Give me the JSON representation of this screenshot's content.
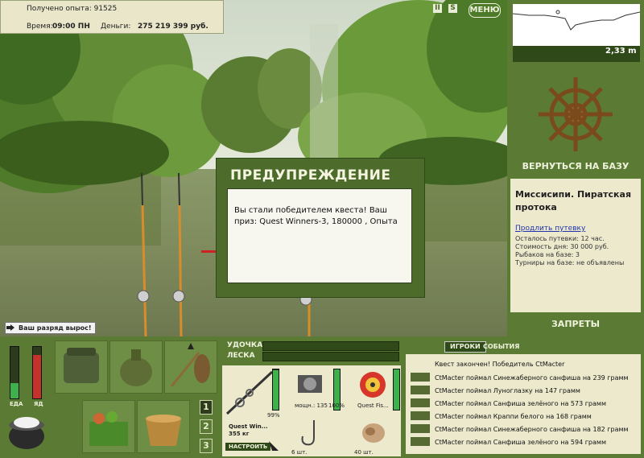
{
  "hud": {
    "exp_label": "Получено опыта: 91525",
    "time_label": "Время:",
    "time_value": "09:00 ПН",
    "money_label": "Деньги:",
    "money_value": "275 219 399 руб.",
    "pause_glyph": "II",
    "sound_glyph": "S",
    "menu_label": "МЕНЮ"
  },
  "depth": {
    "value": "2,33 m"
  },
  "right_panel": {
    "base_button": "ВЕРНУТЬСЯ НА БАЗУ",
    "location_title": "Миссисипи. Пиратская протока",
    "extend_link": "Продлить путевку",
    "trip_left": "Осталось путевки: 12 час.",
    "day_cost": "Стоимость дня: 30 000 руб.",
    "anglers": "Рыбаков на базе: 3",
    "tournaments": "Турниры на базе: не объявлены",
    "bans_button": "ЗАПРЕТЫ"
  },
  "modal": {
    "title": "ПРЕДУПРЕЖДЕНИЕ",
    "message": "Вы стали победителем квеста! Ваш приз: Quest Winners-3, 180000 , Опыта"
  },
  "rank_badge": "Ваш разряд вырос!",
  "needs": {
    "food_label": "ЕДА",
    "poison_label": "ЯД",
    "food_level": 0.3,
    "poison_level": 0.85
  },
  "slots": {
    "pages": [
      "1",
      "2",
      "3"
    ]
  },
  "gear": {
    "rod_label": "УДОЧКА",
    "line_label": "ЛЕСКА",
    "rod_name": "Quest Win...",
    "rod_weight": "355 кг",
    "rod_percent": "99%",
    "setup_button": "НАСТРОИТЬ",
    "reel_power": "мощн.: 135",
    "reel_percent": "100%",
    "line_name": "Quest Fis...",
    "hook_count": "6 шт.",
    "bait_count": "40 шт."
  },
  "log": {
    "tabs": [
      "ИГРОКИ",
      "СОБЫТИЯ"
    ],
    "quest_line": "Квест закончен! Победитель CtMacter",
    "entries": [
      "CtMacter поймал Синежаберного санфиша на 239 грамм",
      "CtMacter поймал Луноглазку на 147 грамм",
      "CtMacter поймал Санфиша зелёного на 573 грамм",
      "CtMacter поймал Краппи белого на 168 грамм",
      "CtMacter поймал Синежаберного санфиша на 182 грамм",
      "CtMacter поймал Санфиша зелёного на 594 грамм"
    ]
  }
}
